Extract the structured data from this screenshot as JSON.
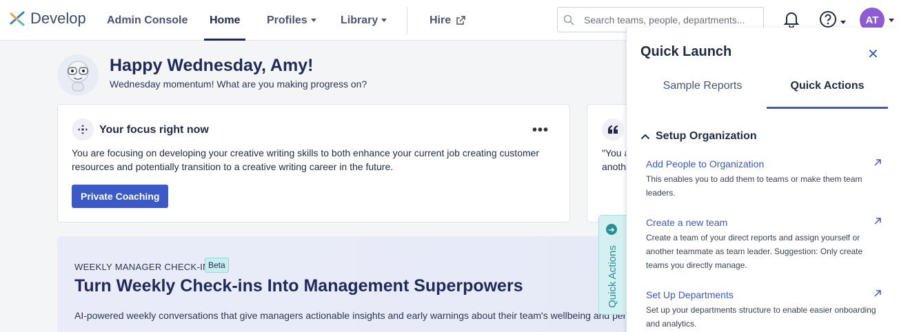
{
  "brand": {
    "name": "Develop"
  },
  "nav": {
    "admin_console": "Admin Console",
    "home": "Home",
    "profiles": "Profiles",
    "library": "Library",
    "hire": "Hire"
  },
  "search": {
    "placeholder": "Search teams, people, departments..."
  },
  "user": {
    "initials": "AT"
  },
  "greeting": {
    "title": "Happy Wednesday, Amy!",
    "subtitle": "Wednesday momentum! What are you making progress on?"
  },
  "focus": {
    "title": "Your focus right now",
    "text": "You are focusing on developing your creative writing skills to both enhance your current job creating customer resources and potentially transition to a creative writing career in the future.",
    "button": "Private Coaching"
  },
  "quote": {
    "text_line1": "\"You a",
    "text_line2": "anoth"
  },
  "checkin": {
    "eyebrow": "WEEKLY MANAGER CHECK-IN",
    "badge": "Beta",
    "title": "Turn Weekly Check-ins Into Management Superpowers",
    "description": "AI-powered weekly conversations that give managers actionable insights and early warnings about their team's wellbeing and perfor"
  },
  "quick_actions_tab": {
    "label": "Quick Actions"
  },
  "panel": {
    "title": "Quick Launch",
    "tabs": {
      "sample_reports": "Sample Reports",
      "quick_actions": "Quick Actions"
    },
    "section": "Setup Organization",
    "actions": [
      {
        "label": "Add People to Organization",
        "desc": "This enables you to add them to teams or make them team leaders."
      },
      {
        "label": "Create a new team",
        "desc": "Create a team of your direct reports and assign yourself or another teammate as team leader. Suggestion: Only create teams you directly manage."
      },
      {
        "label": "Set Up Departments",
        "desc": "Set up your departments structure to enable easier onboarding and analytics."
      }
    ]
  },
  "colors": {
    "accent": "#3b5ac8",
    "teal": "#2b8e96",
    "avatar": "#8e5bd4"
  }
}
